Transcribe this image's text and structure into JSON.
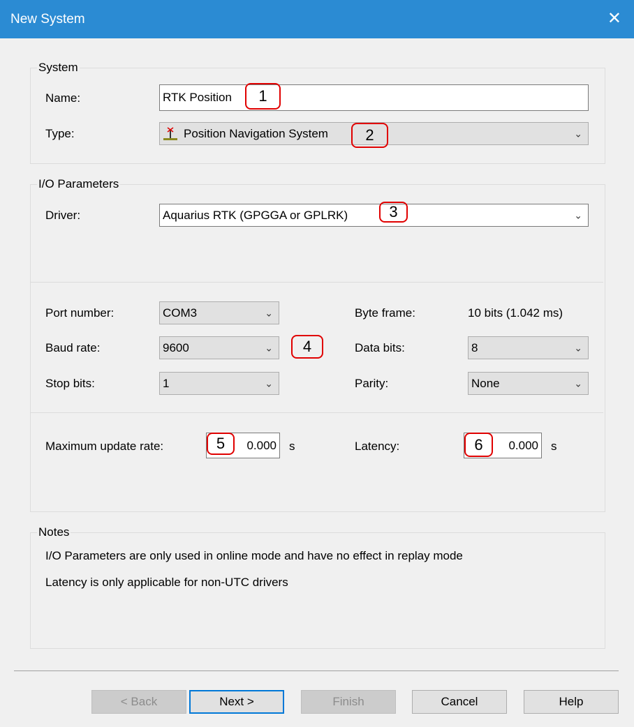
{
  "window": {
    "title": "New System",
    "close": "✕"
  },
  "system": {
    "group": "System",
    "name_label": "Name:",
    "name_value": "RTK Position",
    "type_label": "Type:",
    "type_value": "Position Navigation System"
  },
  "io": {
    "group": "I/O Parameters",
    "driver_label": "Driver:",
    "driver_value": "Aquarius RTK (GPGGA or GPLRK)",
    "port_label": "Port number:",
    "port_value": "COM3",
    "baud_label": "Baud rate:",
    "baud_value": "9600",
    "stop_label": "Stop bits:",
    "stop_value": "1",
    "byte_label": "Byte frame:",
    "byte_value": "10 bits (1.042 ms)",
    "data_label": "Data bits:",
    "data_value": "8",
    "parity_label": "Parity:",
    "parity_value": "None",
    "max_label": "Maximum update rate:",
    "max_value": "0.000",
    "max_unit": "s",
    "lat_label": "Latency:",
    "lat_value": "0.000",
    "lat_unit": "s"
  },
  "notes": {
    "group": "Notes",
    "line1": "I/O Parameters are only used in online mode and have no effect in replay mode",
    "line2": "Latency is only applicable for non-UTC drivers"
  },
  "buttons": {
    "back": "< Back",
    "next": "Next >",
    "finish": "Finish",
    "cancel": "Cancel",
    "help": "Help"
  },
  "annotations": [
    "1",
    "2",
    "3",
    "4",
    "5",
    "6"
  ],
  "colors": {
    "titlebar": "#2b8bd3",
    "annotation": "#e00000",
    "default_button": "#0078d7"
  }
}
